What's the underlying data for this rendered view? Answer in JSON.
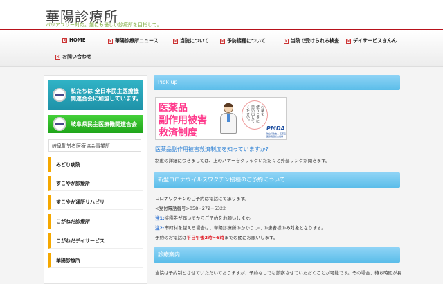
{
  "header": {
    "title": "華陽診療所",
    "tagline": "バリアフリー対応。誰にも優しい診療所を目指して。"
  },
  "nav": {
    "items": [
      {
        "label": "HOME"
      },
      {
        "label": "華陽診療所ニュース"
      },
      {
        "label": "当院について"
      },
      {
        "label": "予防接種について"
      },
      {
        "label": "当院で受けられる検査"
      },
      {
        "label": "デイサービスきんん"
      },
      {
        "label": "お問い合わせ"
      }
    ]
  },
  "sidebar": {
    "banner1": "私たちは 全日本民主医療機関連合会に加盟しています。",
    "banner2": "岐阜県民主医療機関連合会",
    "heading": "岐阜勤労者医療協会事業所",
    "links": [
      {
        "label": "みどり病院"
      },
      {
        "label": "すこやか診療所"
      },
      {
        "label": "すこやか通所リハビリ"
      },
      {
        "label": "こがねだ診療所"
      },
      {
        "label": "こがねだデイサービス"
      },
      {
        "label": "華陽診療所"
      }
    ]
  },
  "main": {
    "pickup_label": "Pick up",
    "pmda_banner": {
      "line1": "医薬品",
      "line2": "副作用被害",
      "line3": "救済制度",
      "bubble_col1": "お薬を",
      "bubble_col2": "使うときに",
      "bubble_col3": "思い出して",
      "bubble_col4": "ください。",
      "logo": "PMDA",
      "logo_sub": "独立行政法人 医薬品医療機器総合機構"
    },
    "pickup_link": "医薬品副作用被害救済制度を知っていますか?",
    "pickup_note": "制度の詳細につきましては、上のバナーをクリックいただくと外部リンクが開きます。",
    "covid_heading": "新型コロナウイルスワクチン接種のご予約について",
    "covid_lines": {
      "l1": "コロナワクチンのご予約は電話にて承ります。",
      "l2": "<受付電話番号>058−272−5322",
      "l3_prefix": "注1:",
      "l3_text": "接種券が届いてからご予約をお願いします。",
      "l4_prefix": "注2:",
      "l4_text": "市町村を越える場合は、華陽診療所のかかりつけの患者様のみ対象となります。",
      "l5_before": "予約のお電話は",
      "l5_hours": "平日午後2時〜5時",
      "l5_after": "までの間にお願いします。"
    },
    "consult_heading": "診療案内",
    "consult_text": "当院は予約制とさせていただいておりますが、予約なしでも診察させていただくことが可能です。その場合、待ち時間が長"
  }
}
